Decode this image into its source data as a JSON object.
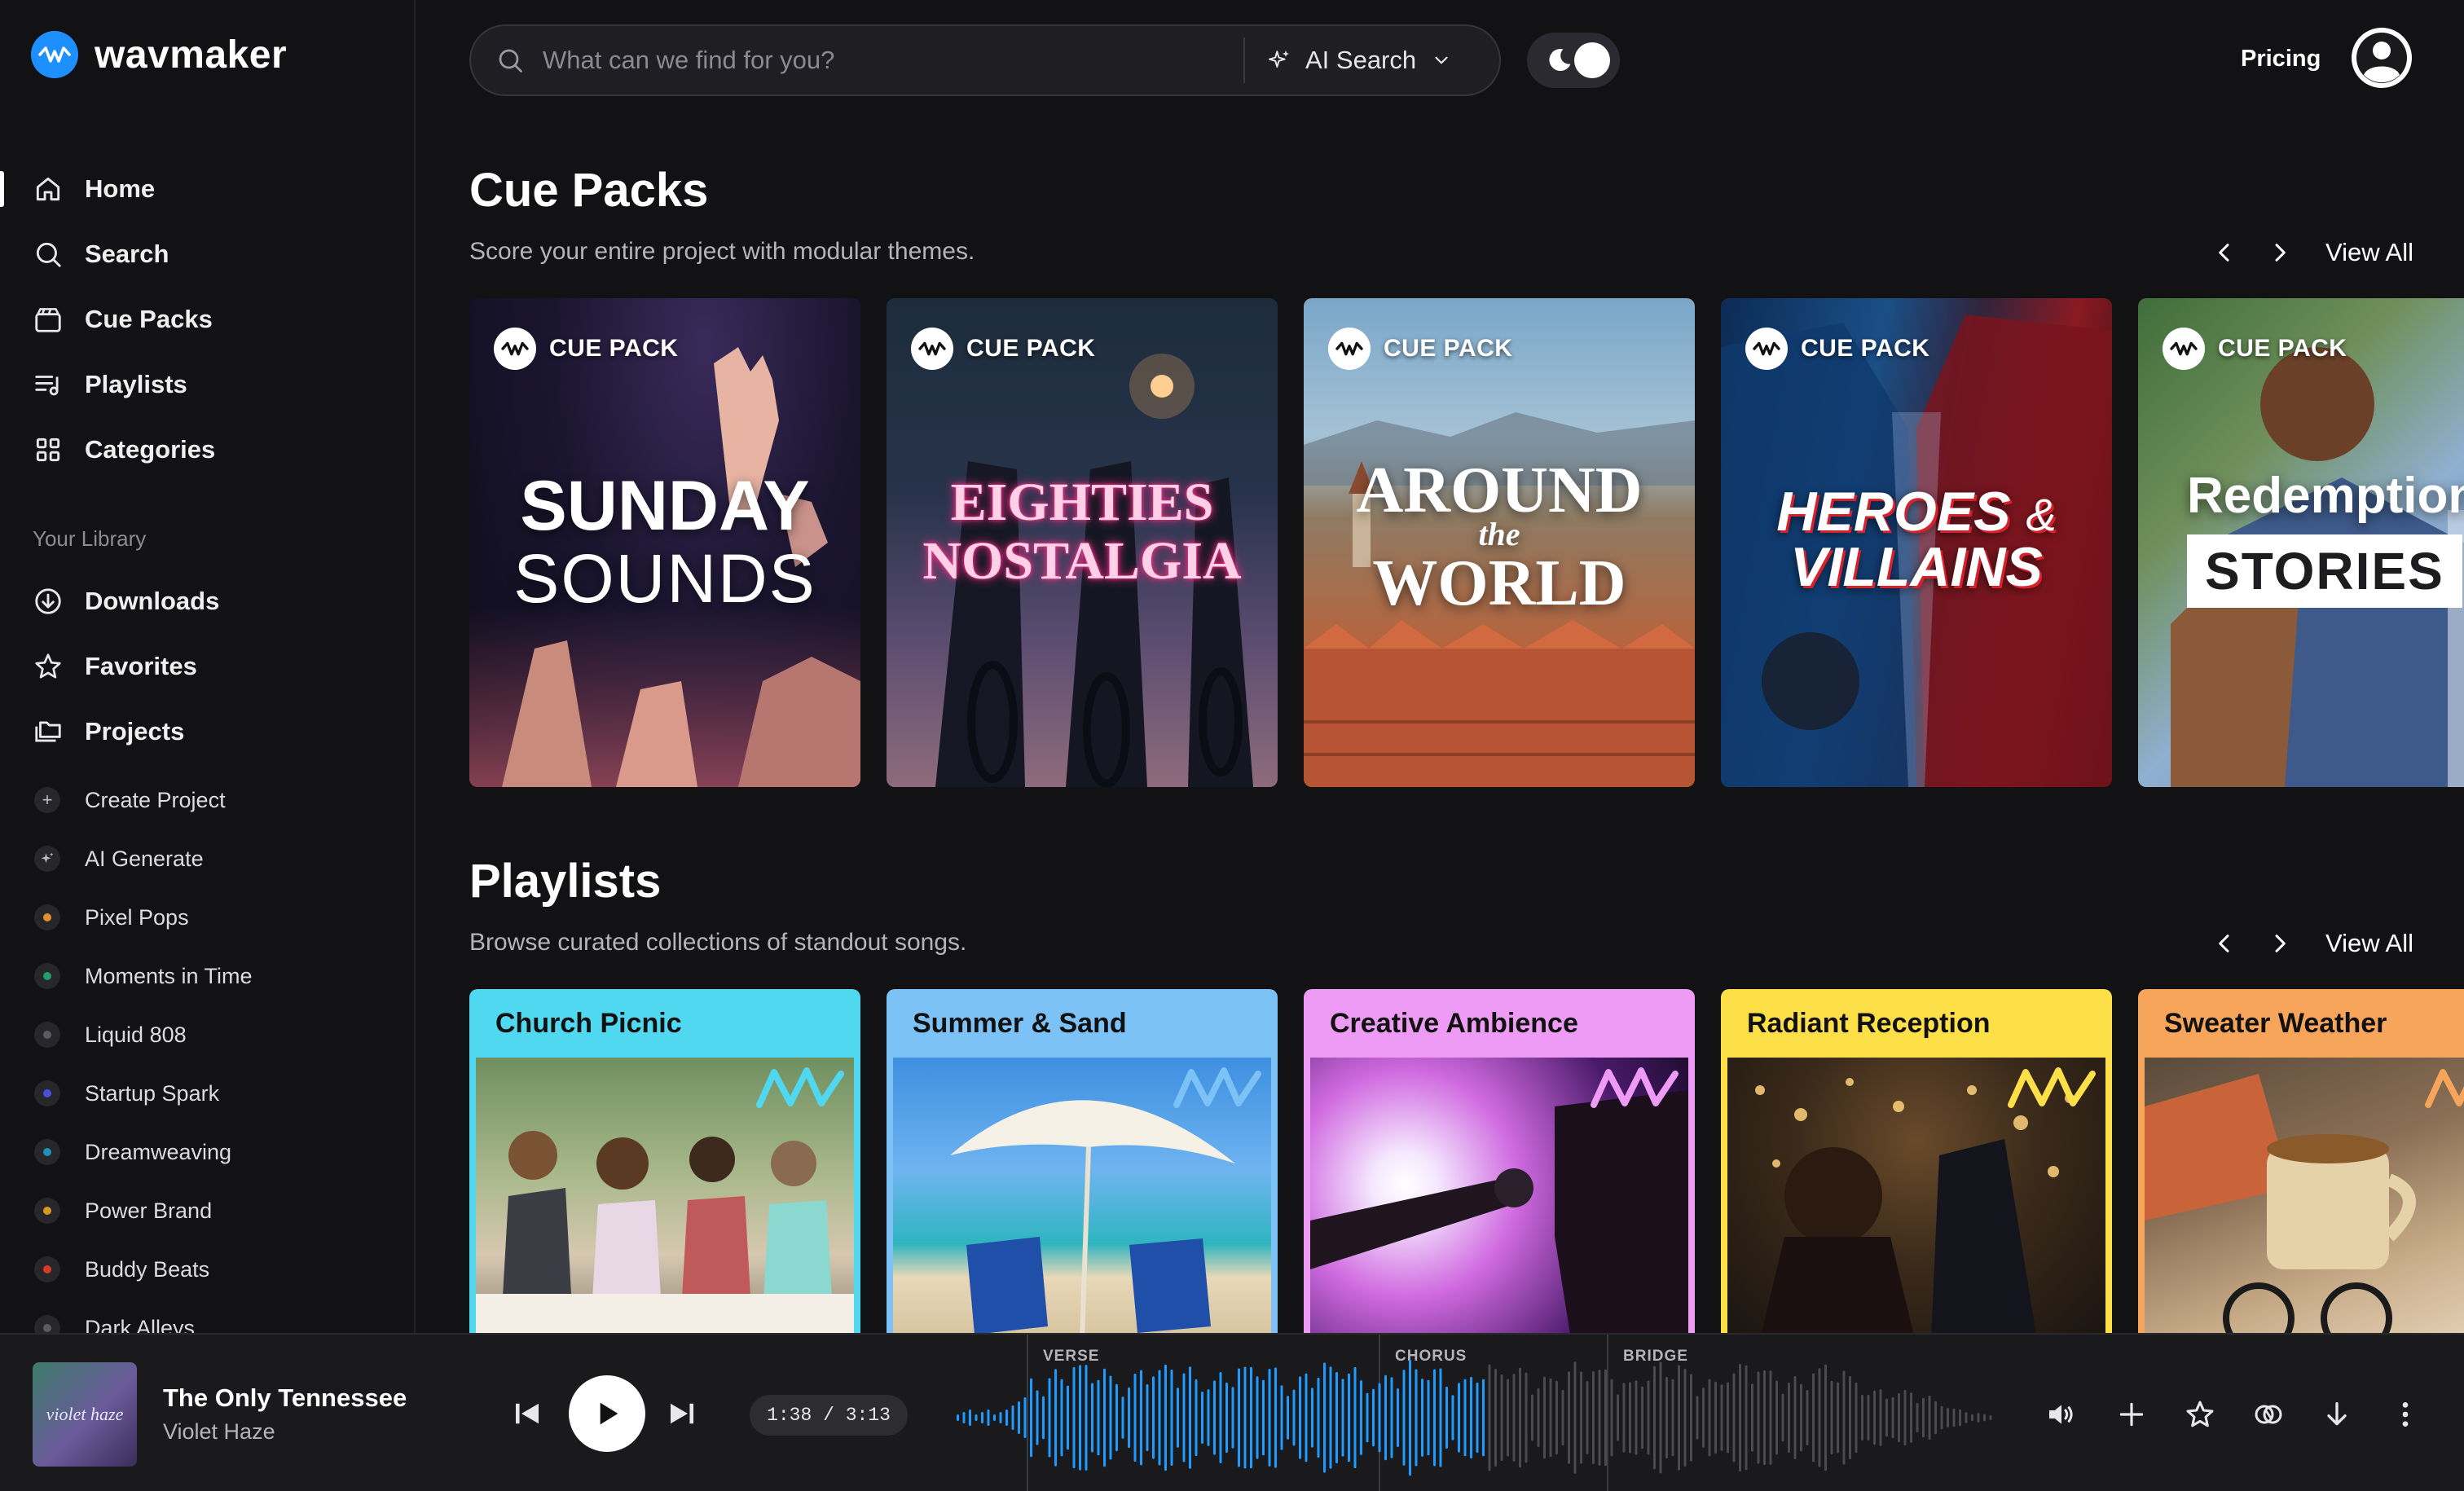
{
  "app": {
    "name": "wavmaker"
  },
  "sidebar": {
    "nav": [
      {
        "label": "Home",
        "icon": "home-icon"
      },
      {
        "label": "Search",
        "icon": "search-icon"
      },
      {
        "label": "Cue Packs",
        "icon": "cue-packs-icon"
      },
      {
        "label": "Playlists",
        "icon": "playlist-icon"
      },
      {
        "label": "Categories",
        "icon": "grid-icon"
      }
    ],
    "library_heading": "Your Library",
    "library": [
      {
        "label": "Downloads",
        "icon": "download-icon"
      },
      {
        "label": "Favorites",
        "icon": "star-icon"
      },
      {
        "label": "Projects",
        "icon": "folder-icon"
      }
    ],
    "projects": [
      {
        "label": "Create Project",
        "icon": "plus-icon",
        "color": ""
      },
      {
        "label": "AI Generate",
        "icon": "sparkle-icon",
        "color": ""
      },
      {
        "label": "Pixel Pops",
        "color": "#e0912a"
      },
      {
        "label": "Moments in Time",
        "color": "#1f9e6b"
      },
      {
        "label": "Liquid 808",
        "color": "#5a5a62"
      },
      {
        "label": "Startup Spark",
        "color": "#4d4de0"
      },
      {
        "label": "Dreamweaving",
        "color": "#1f8fb8"
      },
      {
        "label": "Power Brand",
        "color": "#d89a1e"
      },
      {
        "label": "Buddy Beats",
        "color": "#d83a2a"
      },
      {
        "label": "Dark Alleys",
        "color": "#5a5a62"
      }
    ]
  },
  "header": {
    "search_placeholder": "What can we find for you?",
    "ai_search_label": "AI Search",
    "pricing_label": "Pricing"
  },
  "cue_packs": {
    "title": "Cue Packs",
    "subtitle": "Score your entire project with modular themes.",
    "view_all": "View All",
    "badge": "CUE PACK",
    "items": [
      {
        "line1": "SUNDAY",
        "line2": "SOUNDS"
      },
      {
        "line1": "EIGHTIES",
        "line2": "NOSTALGIA"
      },
      {
        "line1": "AROUND",
        "line_mid": "the",
        "line2": "WORLD"
      },
      {
        "line1": "HEROES",
        "amp": "&",
        "line2": "VILLAINS"
      },
      {
        "line1": "Redemption",
        "line2": "STORIES"
      }
    ]
  },
  "playlists": {
    "title": "Playlists",
    "subtitle": "Browse curated collections of standout songs.",
    "view_all": "View All",
    "items": [
      {
        "title": "Church Picnic",
        "color": "#4fd8f0"
      },
      {
        "title": "Summer & Sand",
        "color": "#7cc2f7"
      },
      {
        "title": "Creative Ambience",
        "color": "#ee9bf5"
      },
      {
        "title": "Radiant Reception",
        "color": "#fde047"
      },
      {
        "title": "Sweater Weather",
        "color": "#f6a55a"
      }
    ]
  },
  "player": {
    "track_title": "The Only Tennessee",
    "artist": "Violet Haze",
    "album_text": "violet haze",
    "time": "1:38 / 3:13",
    "progress": 0.51,
    "sections": [
      "VERSE",
      "CHORUS",
      "BRIDGE"
    ],
    "accent": "#1e9bff"
  }
}
